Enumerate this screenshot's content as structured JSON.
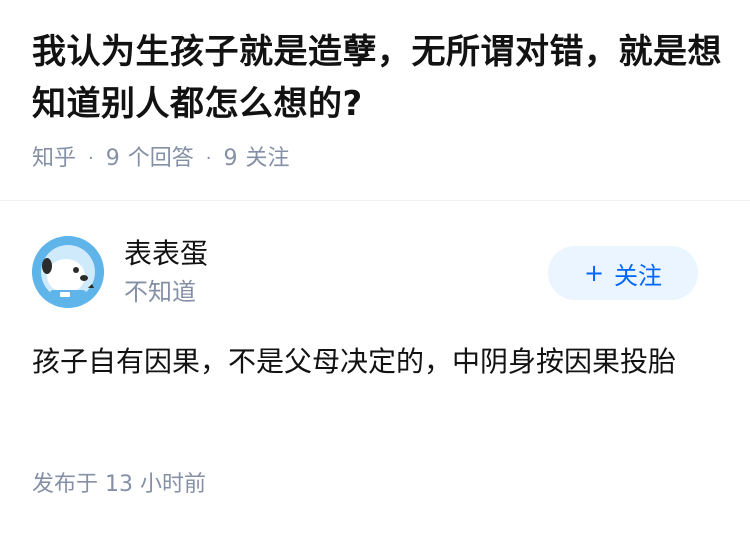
{
  "question": {
    "title": "我认为生孩子就是造孽，无所谓对错，就是想知道别人都怎么想的?",
    "source": "知乎",
    "separator": "·",
    "answer_count": "9",
    "answer_label": "个回答",
    "follower_count": "9",
    "follower_label": "关注"
  },
  "author": {
    "name": "表表蛋",
    "headline": "不知道",
    "avatar_icon": "cartoon-dog-avatar",
    "follow_icon": "+",
    "follow_label": "关注"
  },
  "answer": {
    "content": "孩子自有因果，不是父母决定的，中阴身按因果投胎",
    "time_prefix": "发布于",
    "time_value": "13 小时前"
  },
  "colors": {
    "title": "#121212",
    "meta": "#8590a6",
    "accent": "#0066ff",
    "follow_bg": "#ebf5ff"
  }
}
